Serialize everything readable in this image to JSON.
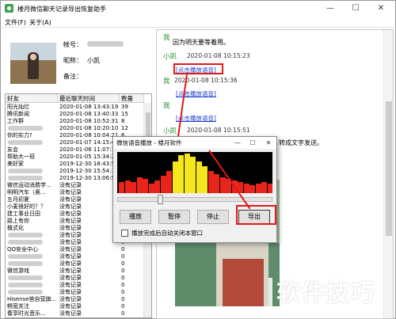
{
  "window": {
    "title": "楼月微信聊天记录导出恢复助手",
    "min": "—",
    "max": "☐",
    "close": "✕"
  },
  "menu": [
    "文件(F)",
    "关于(A)"
  ],
  "profile": {
    "account_label": "帐号：",
    "nick_label": "昵称：",
    "nick_value": "小凯",
    "note_label": "备注："
  },
  "contacts": {
    "headers": [
      "好友",
      "最近聊天时间",
      "数量"
    ],
    "rows": [
      [
        "阳光灿烂",
        "2020-01-08 13:43:19",
        "39"
      ],
      [
        "腾讯新闻",
        "2020-01-08 13:40:33",
        "15"
      ],
      [
        "工作群",
        "2020-01-08 10:52:31",
        "8"
      ],
      [
        "",
        "2020-01-08 10:20:10",
        "12"
      ],
      [
        "你的实力?",
        "2020-01-08 10:04:21",
        "6"
      ],
      [
        "",
        "2020-01-07 14:15:42",
        "2"
      ],
      [
        "友会",
        "2020-01-06 11:07:10",
        "3"
      ],
      [
        "帮助大一班",
        "2020-01-05 15:34:20",
        "1"
      ],
      [
        "美好家",
        "2019-12-30 16:43:51",
        "1"
      ],
      [
        "",
        "2019-12-30 15:54:19",
        "1"
      ],
      [
        "",
        "2019-12-30 13:06:55",
        "1"
      ],
      [
        "微信运动消费学...",
        "没有记录",
        "0"
      ],
      [
        "明明汽车（奥...",
        "没有记录",
        "0"
      ],
      [
        "五月初夏",
        "没有记录",
        "0"
      ],
      [
        "小麦很好的？？",
        "没有记录",
        "0"
      ],
      [
        "建工事业日田",
        "没有记录",
        "0"
      ],
      [
        "路上有你",
        "没有记录",
        "0"
      ],
      [
        "植式化",
        "没有记录",
        "0"
      ],
      [
        "",
        "没有记录",
        "0"
      ],
      [
        "",
        "没有记录",
        "0"
      ],
      [
        "QQ安全中心",
        "没有记录",
        "0"
      ],
      [
        "",
        "没有记录",
        "0"
      ],
      [
        "",
        "没有记录",
        "0"
      ],
      [
        "微信游戏",
        "没有记录",
        "0"
      ],
      [
        "",
        "没有记录",
        "0"
      ],
      [
        "",
        "没有记录",
        "0"
      ],
      [
        "",
        "没有记录",
        "0"
      ],
      [
        "Hisense爸自营旗...",
        "没有记录",
        "0"
      ],
      [
        "畅宽关注",
        "没有记录",
        "0"
      ],
      [
        "春享时光音乐...",
        "没有记录",
        "0"
      ]
    ]
  },
  "chat": {
    "me_label": "我",
    "other_label": "小凯",
    "msg1_text": "因为明天要等着用。",
    "stamp2": "2020-01-08 10:15:23",
    "voice_link": "[点击播放语音]",
    "stamp3": "2020-01-08 10:15:36",
    "stamp4": "2020-01-08 10:15:51",
    "msg4_text": "转成文字发送。"
  },
  "dialog": {
    "title": "微信语音播放 - 楼月软件",
    "buttons": [
      "播放",
      "暂停",
      "停止",
      "导出"
    ],
    "checkbox_label": "播放完成后自动关闭本窗口",
    "checkbox_checked": false,
    "playback_progress": 0.3,
    "spectrum_colors": {
      "low": "#e8251b",
      "high": "#f6e61c"
    }
  },
  "watermark": "软件技巧"
}
